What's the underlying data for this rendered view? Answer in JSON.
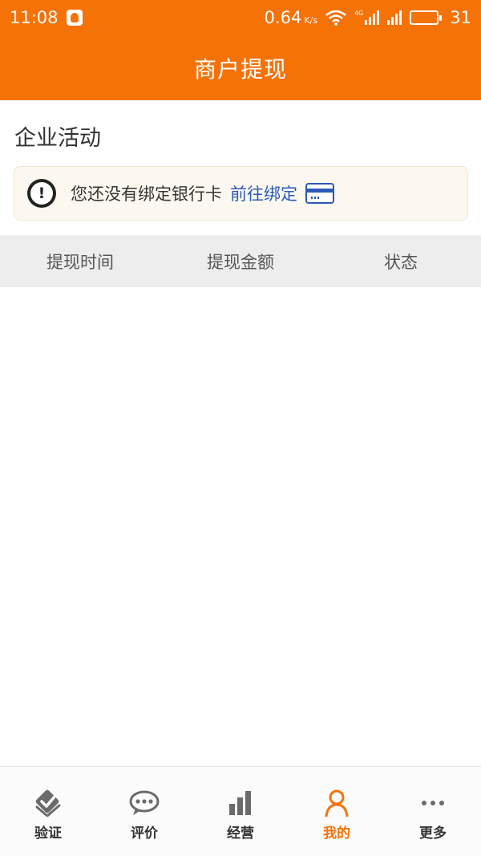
{
  "status_bar": {
    "time": "11:08",
    "speed_value": "0.64",
    "speed_unit": "K/s",
    "network_label": "4G",
    "battery_level": "31"
  },
  "header": {
    "title": "商户提现"
  },
  "section": {
    "title": "企业活动"
  },
  "notice": {
    "message": "您还没有绑定银行卡",
    "link_label": "前往绑定",
    "link_color": "#2a5ab8"
  },
  "table": {
    "columns": [
      "提现时间",
      "提现金额",
      "状态"
    ]
  },
  "tab_bar": {
    "items": [
      {
        "label": "验证",
        "icon": "verify-icon"
      },
      {
        "label": "评价",
        "icon": "comment-icon"
      },
      {
        "label": "经营",
        "icon": "chart-icon"
      },
      {
        "label": "我的",
        "icon": "user-icon",
        "active": true
      },
      {
        "label": "更多",
        "icon": "more-icon"
      }
    ]
  },
  "colors": {
    "brand": "#f57207",
    "link": "#2a5ab8",
    "header_bg": "#ededed"
  }
}
